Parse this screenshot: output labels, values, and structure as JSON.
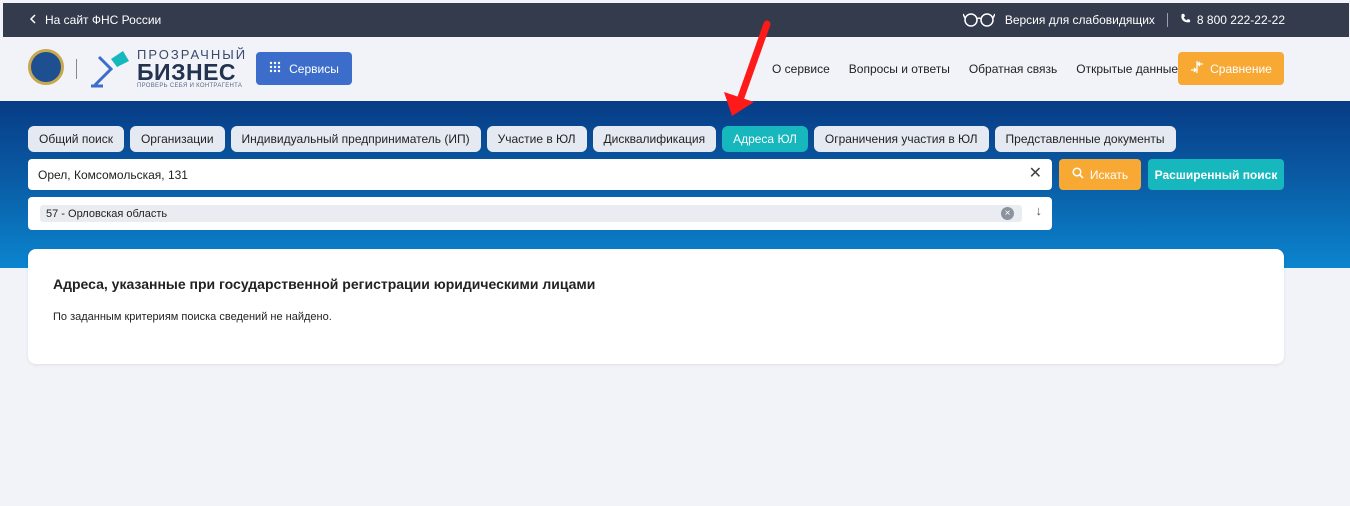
{
  "topbar": {
    "back_link": "На сайт ФНС России",
    "low_vision": "Версия для слабовидящих",
    "phone": "8 800 222-22-22"
  },
  "header": {
    "brand_line1": "ПРОЗРАЧНЫЙ",
    "brand_line2": "БИЗНЕС",
    "brand_line3": "ПРОВЕРЬ СЕБЯ И КОНТРАГЕНТА",
    "services_label": "Сервисы",
    "nav": [
      "О сервисе",
      "Вопросы и ответы",
      "Обратная связь",
      "Открытые данные"
    ],
    "compare_label": "Сравнение"
  },
  "tabs": [
    {
      "label": "Общий поиск"
    },
    {
      "label": "Организации"
    },
    {
      "label": "Индивидуальный предприниматель (ИП)"
    },
    {
      "label": "Участие в ЮЛ"
    },
    {
      "label": "Дисквалификация"
    },
    {
      "label": "Адреса ЮЛ",
      "active": true
    },
    {
      "label": "Ограничения участия в ЮЛ"
    },
    {
      "label": "Представленные документы"
    }
  ],
  "search": {
    "value": "Орел, Комсомольская, 131",
    "search_label": "Искать",
    "advanced_label": "Расширенный поиск"
  },
  "region": {
    "selected": "57 - Орловская область"
  },
  "result": {
    "title": "Адреса, указанные при государственной регистрации юридическими лицами",
    "message": "По заданным критериям поиска сведений не найдено."
  },
  "icons": {
    "back": "chevron-left-icon",
    "glasses": "glasses-icon",
    "phone": "phone-icon",
    "services": "grid-icon",
    "compare": "compare-icon",
    "search": "search-icon",
    "clear": "close-icon",
    "region_clear": "close-circle-icon",
    "region_arrow": "arrow-down-icon"
  },
  "colors": {
    "topbar": "#343b4c",
    "primary_blue": "#3d6dca",
    "accent_orange": "#f7a934",
    "teal": "#16b7bd",
    "hero_dark": "#073c86",
    "hero_light": "#0b85cf",
    "annotation_red": "#ff1a1a"
  }
}
